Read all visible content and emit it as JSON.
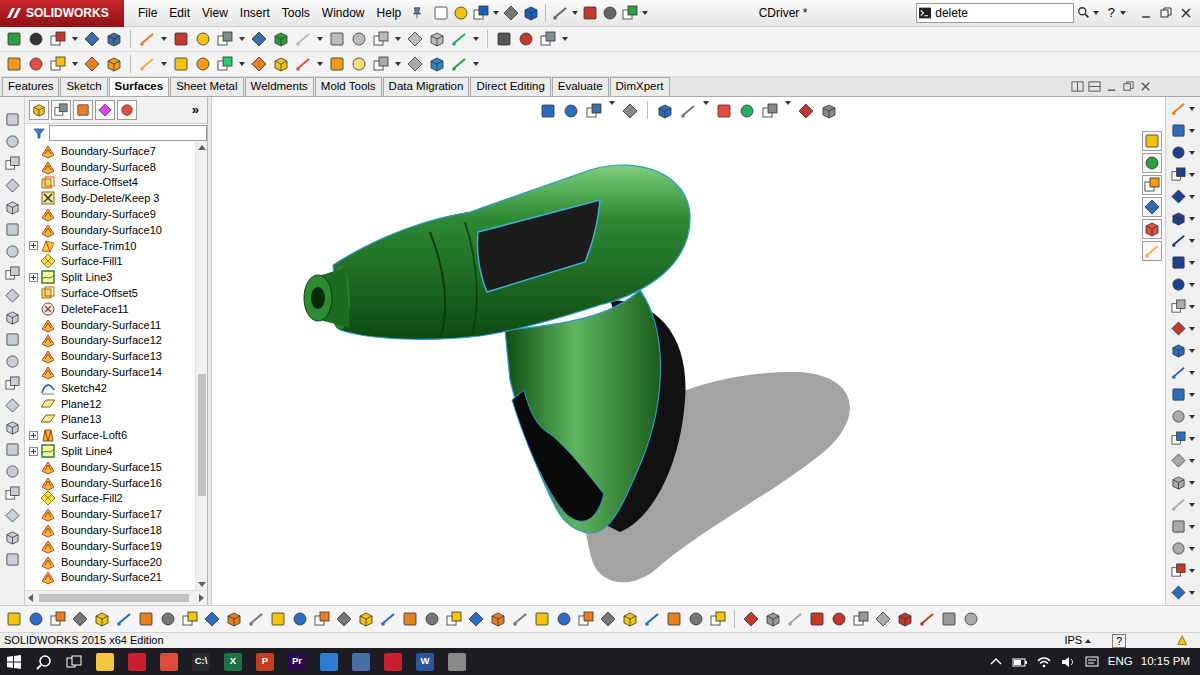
{
  "window": {
    "logo": "SOLIDWORKS",
    "title": "CDriver *",
    "help": "?"
  },
  "menu": [
    "File",
    "Edit",
    "View",
    "Insert",
    "Tools",
    "Window",
    "Help"
  ],
  "search": {
    "value": "delete"
  },
  "tabs": [
    {
      "label": "Features",
      "selected": false
    },
    {
      "label": "Sketch",
      "selected": false
    },
    {
      "label": "Surfaces",
      "selected": true
    },
    {
      "label": "Sheet Metal",
      "selected": false
    },
    {
      "label": "Weldments",
      "selected": false
    },
    {
      "label": "Mold Tools",
      "selected": false
    },
    {
      "label": "Data Migration",
      "selected": false
    },
    {
      "label": "Direct Editing",
      "selected": false
    },
    {
      "label": "Evaluate",
      "selected": false
    },
    {
      "label": "DimXpert",
      "selected": false
    }
  ],
  "tree": {
    "more": "»",
    "scroll_level": 0.73,
    "hscroll_level": 0,
    "items": [
      {
        "label": "Boundary-Surface7",
        "kind": "boundary",
        "expandable": false
      },
      {
        "label": "Boundary-Surface8",
        "kind": "boundary",
        "expandable": false
      },
      {
        "label": "Surface-Offset4",
        "kind": "offset",
        "expandable": false
      },
      {
        "label": "Body-Delete/Keep 3",
        "kind": "deletebody",
        "expandable": false
      },
      {
        "label": "Boundary-Surface9",
        "kind": "boundary",
        "expandable": false
      },
      {
        "label": "Boundary-Surface10",
        "kind": "boundary",
        "expandable": false
      },
      {
        "label": "Surface-Trim10",
        "kind": "trim",
        "expandable": true
      },
      {
        "label": "Surface-Fill1",
        "kind": "fill",
        "expandable": false
      },
      {
        "label": "Split Line3",
        "kind": "split",
        "expandable": true
      },
      {
        "label": "Surface-Offset5",
        "kind": "offset",
        "expandable": false
      },
      {
        "label": "DeleteFace11",
        "kind": "deleteface",
        "expandable": false
      },
      {
        "label": "Boundary-Surface11",
        "kind": "boundary",
        "expandable": false
      },
      {
        "label": "Boundary-Surface12",
        "kind": "boundary",
        "expandable": false
      },
      {
        "label": "Boundary-Surface13",
        "kind": "boundary",
        "expandable": false
      },
      {
        "label": "Boundary-Surface14",
        "kind": "boundary",
        "expandable": false
      },
      {
        "label": "Sketch42",
        "kind": "sketch",
        "expandable": false
      },
      {
        "label": "Plane12",
        "kind": "plane",
        "expandable": false
      },
      {
        "label": "Plane13",
        "kind": "plane",
        "expandable": false
      },
      {
        "label": "Surface-Loft6",
        "kind": "loft",
        "expandable": true
      },
      {
        "label": "Split Line4",
        "kind": "split",
        "expandable": true
      },
      {
        "label": "Boundary-Surface15",
        "kind": "boundary",
        "expandable": false
      },
      {
        "label": "Boundary-Surface16",
        "kind": "boundary",
        "expandable": false
      },
      {
        "label": "Surface-Fill2",
        "kind": "fill",
        "expandable": false
      },
      {
        "label": "Boundary-Surface17",
        "kind": "boundary",
        "expandable": false
      },
      {
        "label": "Boundary-Surface18",
        "kind": "boundary",
        "expandable": false
      },
      {
        "label": "Boundary-Surface19",
        "kind": "boundary",
        "expandable": false
      },
      {
        "label": "Boundary-Surface20",
        "kind": "boundary",
        "expandable": false
      },
      {
        "label": "Boundary-Surface21",
        "kind": "boundary",
        "expandable": false
      }
    ]
  },
  "status_bar": {
    "edition": "SOLIDWORKS 2015 x64 Edition",
    "units": "IPS",
    "help": "?"
  },
  "taskbar": {
    "apps": [
      {
        "color": "#f4c542"
      },
      {
        "color": "#c8202e"
      },
      {
        "color": "#dd4b39"
      },
      {
        "color": "#2b2b2b",
        "label": "C:\\"
      },
      {
        "color": "#1e7145",
        "label": "X"
      },
      {
        "color": "#c43e1c",
        "label": "P"
      },
      {
        "color": "#2a0a4a",
        "label": "Pr"
      },
      {
        "color": "#2d7dd2"
      },
      {
        "color": "#4a6fa5"
      },
      {
        "color": "#c8202e"
      },
      {
        "color": "#2b579a",
        "label": "W"
      },
      {
        "color": "#8a8a8a"
      }
    ],
    "language": "ENG",
    "time": "10:15 PM"
  }
}
